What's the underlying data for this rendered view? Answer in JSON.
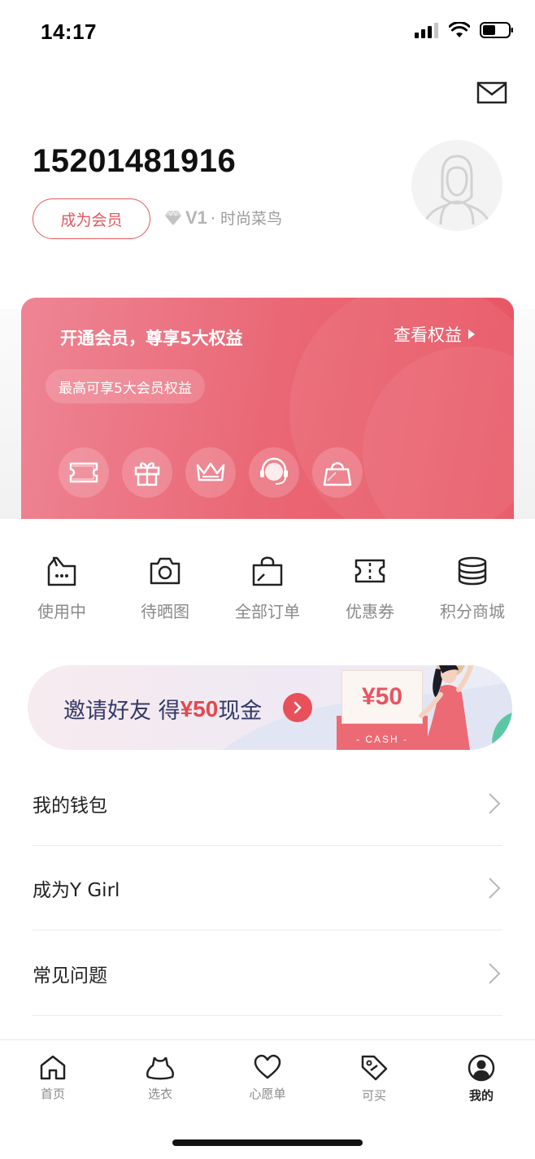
{
  "status_bar": {
    "time": "14:17"
  },
  "profile": {
    "phone": "15201481916",
    "become_member_label": "成为会员",
    "level_code": "V1",
    "level_name": "· 时尚菜鸟"
  },
  "member_card": {
    "title": "开通会员，尊享5大权益",
    "link_label": "查看权益",
    "pill_text": "最高可享5大会员权益",
    "benefit_icons": [
      "ticket-icon",
      "gift-icon",
      "crown-icon",
      "service-icon",
      "shopping-bag-icon"
    ]
  },
  "shortcuts": [
    {
      "label": "使用中",
      "icon": "box-dots-icon"
    },
    {
      "label": "待晒图",
      "icon": "camera-icon"
    },
    {
      "label": "全部订单",
      "icon": "bag-icon"
    },
    {
      "label": "优惠券",
      "icon": "coupon-icon"
    },
    {
      "label": "积分商城",
      "icon": "coins-icon"
    }
  ],
  "banner": {
    "text_prefix": "邀请好友 得 ",
    "amount": "¥50",
    "text_suffix": "现金",
    "cash_amount": "¥50",
    "cash_label": "- CASH -"
  },
  "menu": [
    {
      "label": "我的钱包"
    },
    {
      "label": "成为Y Girl"
    },
    {
      "label": "常见问题"
    }
  ],
  "tabbar": {
    "active_index": 4,
    "items": [
      {
        "label": "首页",
        "icon": "home-icon"
      },
      {
        "label": "选衣",
        "icon": "dress-icon"
      },
      {
        "label": "心愿单",
        "icon": "heart-icon"
      },
      {
        "label": "可买",
        "icon": "tag-icon"
      },
      {
        "label": "我的",
        "icon": "user-icon"
      }
    ]
  },
  "colors": {
    "accent": "#e2595d",
    "card": "#ea6876",
    "banner_text": "#333a66"
  }
}
